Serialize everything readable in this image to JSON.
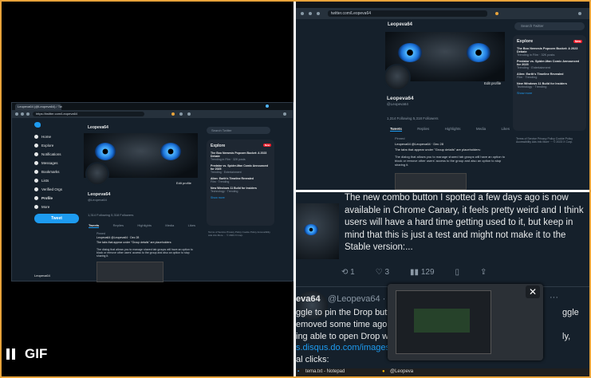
{
  "gif_label": "GIF",
  "browser": {
    "tab_title": "Leopeva64 (@Leopeva64) / Tw",
    "url": "twitter.com/Leopeva64",
    "url_full": "https://twitter.com/Leopeva64"
  },
  "sidebar": {
    "items": [
      "Home",
      "Explore",
      "Notifications",
      "Messages",
      "Bookmarks",
      "Lists",
      "Verified Orgs",
      "Profile",
      "More"
    ],
    "tweet_button": "Tweet",
    "account_name": "Leopeva64"
  },
  "profile": {
    "name": "Leopeva64",
    "handle": "@Leopeva64",
    "edit_button": "Edit profile",
    "stats": "1,314 Following   5,318 Followers",
    "tabs": [
      "Tweets",
      "Replies",
      "Highlights",
      "Media",
      "Likes"
    ],
    "pinned": "Pinned",
    "tweet_author": "Leopeva64 @Leopeva64 · Dec 28",
    "tweet_text": "The tabs that appear under \"Group details\" are placeholders:",
    "tweet_text2": "The dialog that allows you to manage shared tab groups will have an option to block or remove other users' access to the group and also an option to stop sharing it."
  },
  "search": {
    "placeholder": "Search Twitter"
  },
  "explore": {
    "title": "Explore",
    "badge": "New",
    "items": [
      {
        "title": "The Boo Nemesis Popcorn Bucket: A 2023 Debate",
        "meta": "Trending in Film · 32K posts"
      },
      {
        "title": "Predator vs. Spider-Man Comic Announced for 2025",
        "meta": "Trending · Entertainment"
      },
      {
        "title": "Alien: Earth's Timeline Revealed",
        "meta": "Film · Trending"
      },
      {
        "title": "New Windows 11 Build for Insiders",
        "meta": "Technology · Trending"
      }
    ],
    "show_more": "Show more",
    "footer": "Terms of Service  Privacy Policy  Cookie Policy  Accessibility  Ads info  More ··· © 2023 X Corp."
  },
  "zoom": {
    "text": "The new combo button I spotted a few days ago is now available in Chrome Canary, it feels pretty weird and I think users will have a hard time getting used to it, but keep in mind that this is just a test and might not make it to the Stable version:...",
    "replies": "1",
    "likes": "3",
    "views": "129",
    "next_author": "eva64",
    "next_handle": "@Leopeva64 · 12h",
    "next_lines": [
      "ggle to pin the Drop butto",
      "emoved some time ago (I d",
      "ing able to open Drop with",
      "al clicks:"
    ],
    "next_right": [
      "ggle",
      "ly,"
    ],
    "link": "s.disqus.do.com/images",
    "close": "✕",
    "taskbar": [
      "tema.txt - Notepad",
      "@Leopeva"
    ]
  }
}
